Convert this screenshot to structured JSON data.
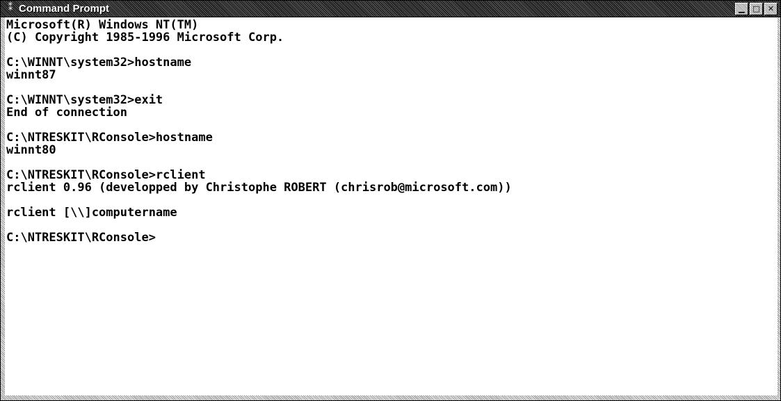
{
  "window": {
    "title": "Command Prompt",
    "icon": "command-prompt-icon",
    "buttons": [
      {
        "name": "minimize",
        "icon": "minimize-icon",
        "glyph": "▁"
      },
      {
        "name": "maximize",
        "icon": "maximize-icon",
        "glyph": "□"
      },
      {
        "name": "close",
        "icon": "close-icon",
        "glyph": "✕"
      }
    ]
  },
  "console": {
    "lines": [
      "Microsoft(R) Windows NT(TM)",
      "(C) Copyright 1985-1996 Microsoft Corp.",
      "",
      "C:\\WINNT\\system32>hostname",
      "winnt87",
      "",
      "C:\\WINNT\\system32>exit",
      "End of connection",
      "",
      "C:\\NTRESKIT\\RConsole>hostname",
      "winnt80",
      "",
      "C:\\NTRESKIT\\RConsole>rclient",
      "rclient 0.96 (developped by Christophe ROBERT (chrisrob@microsoft.com))",
      "",
      "rclient [\\\\]computername",
      "",
      "C:\\NTRESKIT\\RConsole>"
    ]
  },
  "colors": {
    "background": "#ffffff",
    "text": "#000000",
    "titlebar": "#3a3a3a"
  }
}
